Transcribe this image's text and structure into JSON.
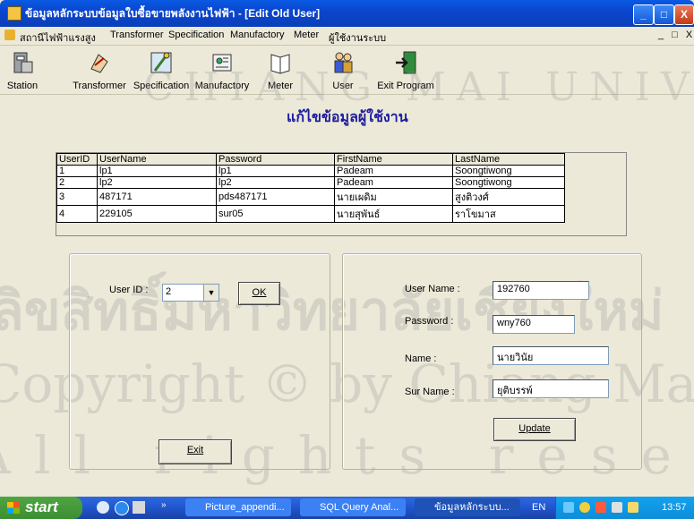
{
  "window": {
    "title": "ข้อมูลหลักระบบข้อมูลใบซื้อขายพลังงานไฟฟ้า - [Edit Old User]",
    "controls": {
      "minimize": "_",
      "maximize": "□",
      "close": "X"
    },
    "mdi_controls": "_ □ X"
  },
  "menu": {
    "items": [
      "สถานีไฟฟ้าแรงสูง",
      "Transformer",
      "Specification",
      "Manufactory",
      "Meter",
      "ผู้ใช้งานระบบ"
    ]
  },
  "toolbar": {
    "buttons": [
      {
        "label": "Station",
        "icon": "station-icon"
      },
      {
        "label": "Transformer",
        "icon": "transformer-icon"
      },
      {
        "label": "Specification",
        "icon": "specification-icon"
      },
      {
        "label": "Manufactory",
        "icon": "manufactory-icon"
      },
      {
        "label": "Meter",
        "icon": "meter-icon"
      },
      {
        "label": "User",
        "icon": "user-icon"
      },
      {
        "label": "Exit Program",
        "icon": "exit-icon"
      }
    ]
  },
  "page": {
    "heading": "แก้ไขข้อมูลผู้ใช้งาน"
  },
  "users_table": {
    "columns": [
      "UserID",
      "UserName",
      "Password",
      "FirstName",
      "LastName"
    ],
    "rows": [
      [
        "1",
        "lp1",
        "lp1",
        "Padeam",
        "Soongtiwong"
      ],
      [
        "2",
        "lp2",
        "lp2",
        "Padeam",
        "Soongtiwong"
      ],
      [
        "3",
        "487171",
        "pds487171",
        "นายเผดิม",
        "สูงติวงศ์"
      ],
      [
        "4",
        "229105",
        "sur05",
        "นายสุพันธ์",
        "ราโขมาส"
      ]
    ]
  },
  "left_panel": {
    "userid_label": "User ID :",
    "userid_value": "2",
    "ok_label": "OK",
    "exit_label": "Exit"
  },
  "right_panel": {
    "username_label": "User Name :",
    "username_value": "192760",
    "password_label": "Password :",
    "password_value": "wny760",
    "name_label": "Name :",
    "name_value": "นายวินัย",
    "surname_label": "Sur Name :",
    "surname_value": "ยุติบรรพ์",
    "update_label": "Update"
  },
  "watermark": {
    "line1": "ลิขสิทธิ์มหาวิทยาลัยเชียงใหม่",
    "line2": "Copyright © by Chiang Mai University",
    "line3": "All rights reserved",
    "arc": "CHIANG MAI UNIVERSITY"
  },
  "taskbar": {
    "start_label": "start",
    "tasks": [
      "Picture_appendi...",
      "SQL Query Anal...",
      "ข้อมูลหลักระบบ..."
    ],
    "language": "EN",
    "time": "13:57"
  }
}
